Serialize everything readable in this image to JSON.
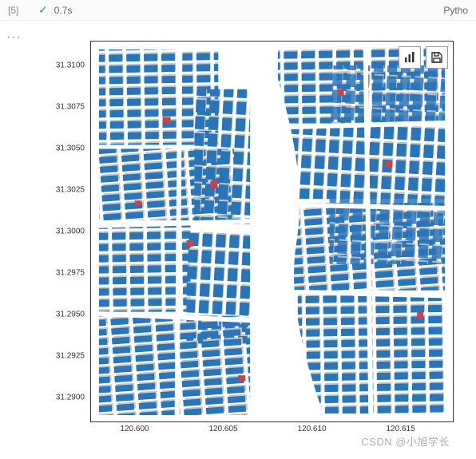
{
  "header": {
    "exec_count": "[5]",
    "check_glyph": "✓",
    "exec_time": "0.7s",
    "kernel_label": "Pytho"
  },
  "gutter": {
    "ellipsis": "···"
  },
  "chart_data": {
    "type": "map",
    "description": "Urban building footprints colored by attribute along a river corridor",
    "xlabel": "",
    "ylabel": "",
    "x_ticks": [
      "120.600",
      "120.605",
      "120.610",
      "120.615"
    ],
    "y_ticks": [
      "31.3100",
      "31.3075",
      "31.3050",
      "31.3025",
      "31.3000",
      "31.2975",
      "31.2950",
      "31.2925",
      "31.2900"
    ],
    "xlim": [
      120.5975,
      120.618
    ],
    "ylim": [
      31.2885,
      31.3115
    ],
    "colors": {
      "primary": "#2a74b8",
      "shadow": "#c5c5c5",
      "highlight": "#c9414a",
      "river": "#ffffff"
    }
  },
  "toolbar": {
    "chart_btn_name": "chart-icon",
    "save_btn_name": "save-icon"
  },
  "watermark": "CSDN @小旭学长"
}
